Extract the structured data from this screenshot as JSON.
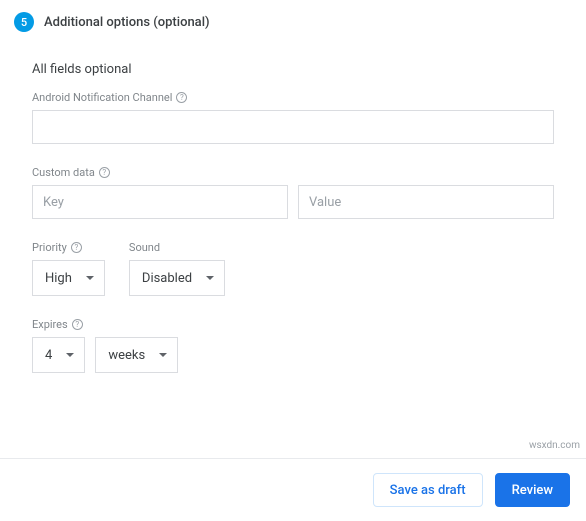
{
  "step": {
    "number": "5",
    "title": "Additional options (optional)"
  },
  "section_heading": "All fields optional",
  "channel": {
    "label": "Android Notification Channel",
    "value": ""
  },
  "custom_data": {
    "label": "Custom data",
    "key_placeholder": "Key",
    "value_placeholder": "Value"
  },
  "priority": {
    "label": "Priority",
    "value": "High"
  },
  "sound": {
    "label": "Sound",
    "value": "Disabled"
  },
  "expires": {
    "label": "Expires",
    "amount": "4",
    "unit": "weeks"
  },
  "footer": {
    "save_draft": "Save as draft",
    "review": "Review"
  },
  "watermark": "wsxdn.com"
}
